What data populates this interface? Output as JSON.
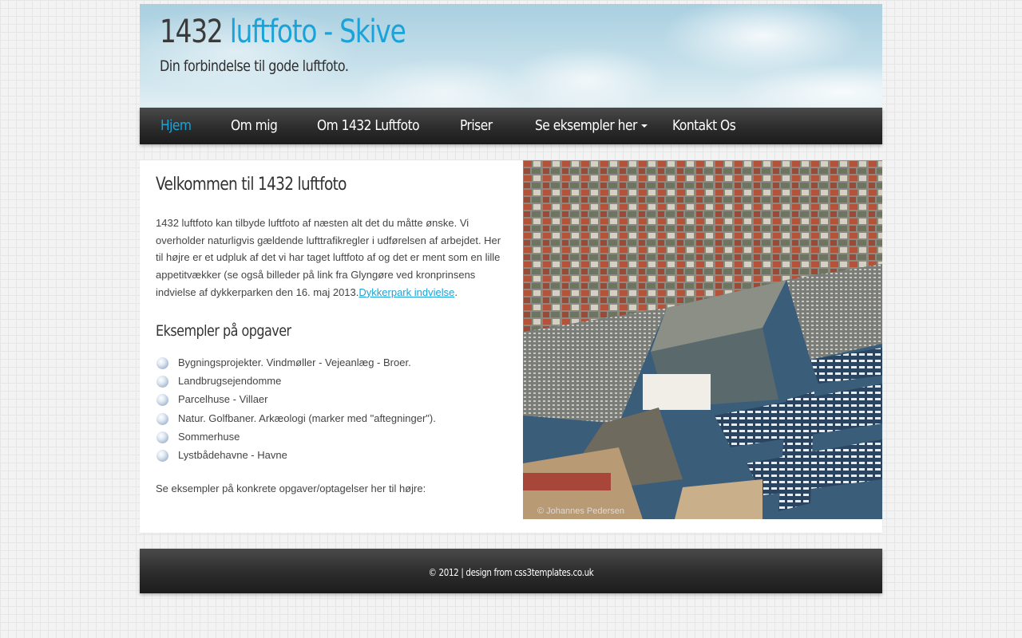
{
  "header": {
    "title_number": "1432",
    "title_rest": "luftfoto - Skive",
    "slogan": "Din forbindelse til gode luftfoto."
  },
  "nav": {
    "items": [
      {
        "label": "Hjem",
        "active": true
      },
      {
        "label": "Om mig"
      },
      {
        "label": "Om 1432 Luftfoto"
      },
      {
        "label": "Priser"
      },
      {
        "label": "Se eksempler her",
        "has_dropdown": true
      },
      {
        "label": "Kontakt Os"
      }
    ]
  },
  "main": {
    "heading": "Velkommen til 1432 luftfoto",
    "intro_text": "1432 luftfoto kan tilbyde luftfoto af næsten alt det du måtte ønske. Vi overholder naturligvis gældende lufttrafikregler i udførelsen af arbejdet. Her til højre er et udpluk af det vi har taget luftfoto af og det er ment som en lille appetitvækker (se også billeder på link fra Glyngøre ved kronprinsens indvielse af dykkerparken den 16. maj 2013.",
    "intro_link": "Dykkerpark indvielse",
    "intro_end": ".",
    "subheading": "Eksempler på opgaver",
    "examples": [
      "Bygningsprojekter. Vindmøller - Vejeanlæg - Broer.",
      "Landbrugsejendomme",
      "Parcelhuse - Villaer",
      "Natur. Golfbaner. Arkæologi (marker med \"aftegninger\").",
      "Sommerhuse",
      "Lystbådehavne - Havne"
    ],
    "closing_text": "Se eksempler på konkrete opgaver/optagelser her til højre:"
  },
  "photo": {
    "subject": "aerial photo of harbour and town",
    "watermark": "© Johannes Pedersen"
  },
  "footer": {
    "text": "© 2012 | design from css3templates.co.uk"
  },
  "colors": {
    "accent": "#1aa3d9",
    "nav_bg": "#2c2c2c",
    "text": "#444444"
  }
}
